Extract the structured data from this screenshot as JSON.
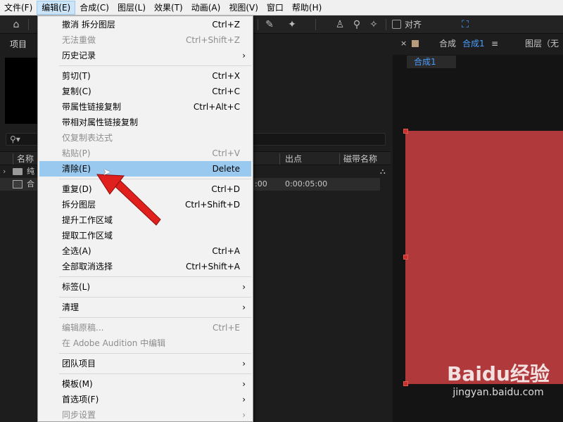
{
  "menubar": {
    "items": [
      {
        "label": "文件(F)"
      },
      {
        "label": "编辑(E)"
      },
      {
        "label": "合成(C)"
      },
      {
        "label": "图层(L)"
      },
      {
        "label": "效果(T)"
      },
      {
        "label": "动画(A)"
      },
      {
        "label": "视图(V)"
      },
      {
        "label": "窗口"
      },
      {
        "label": "帮助(H)"
      }
    ]
  },
  "toolbar": {
    "snap_label": "对齐"
  },
  "project": {
    "tab_label": "项目",
    "columns": {
      "name": "名称",
      "out_point": "出点",
      "tape_name": "磁带名称"
    },
    "rows": [
      {
        "name": "纯",
        "col_a": "",
        "col_b": ""
      },
      {
        "name": "合",
        "col_a": ":00",
        "col_b": "0:00:05:00"
      }
    ]
  },
  "comp": {
    "tab_label": "合成",
    "tab_name": "合成1",
    "subtab": "合成1",
    "layer_tab": "图层（无",
    "canvas_color": "#b0393b"
  },
  "edit_menu": {
    "items": [
      {
        "label": "撤消 拆分图层",
        "shortcut": "Ctrl+Z"
      },
      {
        "label": "无法重做",
        "shortcut": "Ctrl+Shift+Z"
      },
      {
        "label": "历史记录",
        "shortcut": ""
      },
      {
        "label": "剪切(T)",
        "shortcut": "Ctrl+X"
      },
      {
        "label": "复制(C)",
        "shortcut": "Ctrl+C"
      },
      {
        "label": "带属性链接复制",
        "shortcut": "Ctrl+Alt+C"
      },
      {
        "label": "带相对属性链接复制",
        "shortcut": ""
      },
      {
        "label": "仅复制表达式",
        "shortcut": ""
      },
      {
        "label": "粘贴(P)",
        "shortcut": "Ctrl+V"
      },
      {
        "label": "清除(E)",
        "shortcut": "Delete"
      },
      {
        "label": "重复(D)",
        "shortcut": "Ctrl+D"
      },
      {
        "label": "拆分图层",
        "shortcut": "Ctrl+Shift+D"
      },
      {
        "label": "提升工作区域",
        "shortcut": ""
      },
      {
        "label": "提取工作区域",
        "shortcut": ""
      },
      {
        "label": "全选(A)",
        "shortcut": "Ctrl+A"
      },
      {
        "label": "全部取消选择",
        "shortcut": "Ctrl+Shift+A"
      },
      {
        "label": "标签(L)",
        "shortcut": ""
      },
      {
        "label": "清理",
        "shortcut": ""
      },
      {
        "label": "编辑原稿...",
        "shortcut": "Ctrl+E"
      },
      {
        "label": "在 Adobe Audition 中编辑",
        "shortcut": ""
      },
      {
        "label": "团队项目",
        "shortcut": ""
      },
      {
        "label": "模板(M)",
        "shortcut": ""
      },
      {
        "label": "首选项(F)",
        "shortcut": ""
      },
      {
        "label": "同步设置",
        "shortcut": ""
      }
    ]
  },
  "watermark": {
    "logo": "Baidu经验",
    "url": "jingyan.baidu.com"
  },
  "colors": {
    "menu_highlight": "#99c9ef",
    "annotation_arrow": "#e0201c",
    "accent_blue": "#4a9eff"
  }
}
